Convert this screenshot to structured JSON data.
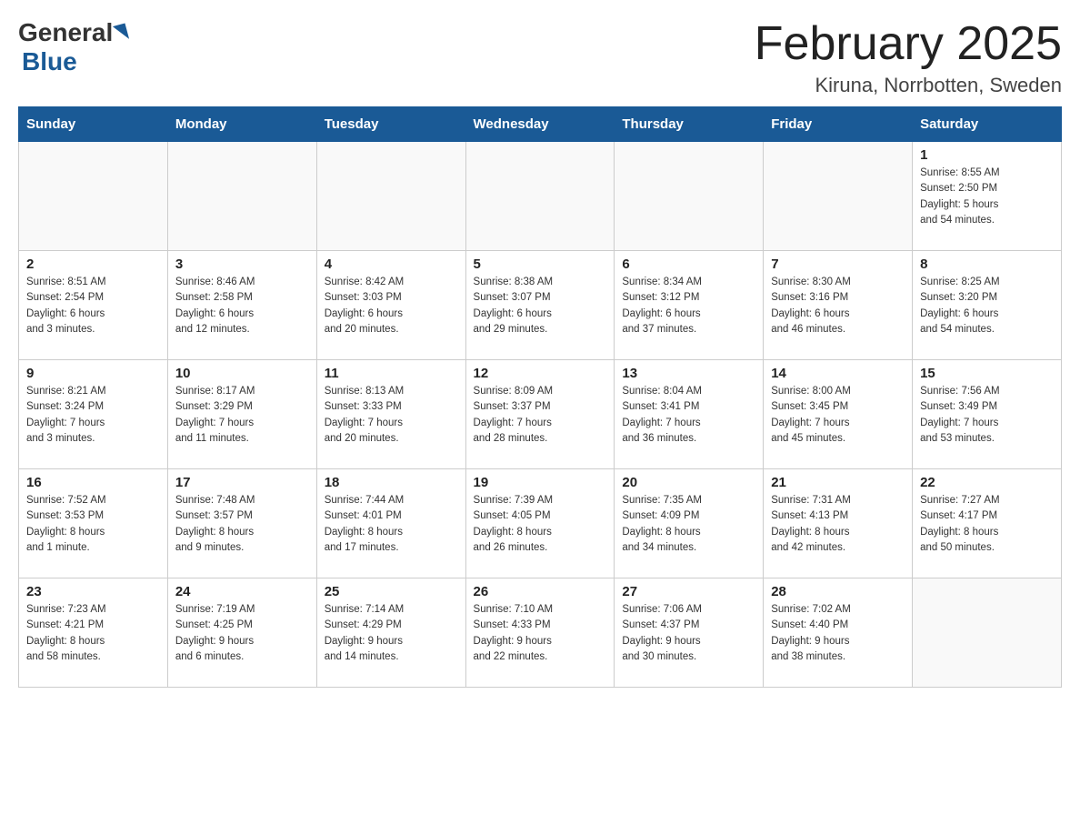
{
  "header": {
    "logo_general": "General",
    "logo_blue": "Blue",
    "title": "February 2025",
    "subtitle": "Kiruna, Norrbotten, Sweden"
  },
  "days_of_week": [
    "Sunday",
    "Monday",
    "Tuesday",
    "Wednesday",
    "Thursday",
    "Friday",
    "Saturday"
  ],
  "weeks": [
    {
      "days": [
        {
          "number": "",
          "info": ""
        },
        {
          "number": "",
          "info": ""
        },
        {
          "number": "",
          "info": ""
        },
        {
          "number": "",
          "info": ""
        },
        {
          "number": "",
          "info": ""
        },
        {
          "number": "",
          "info": ""
        },
        {
          "number": "1",
          "info": "Sunrise: 8:55 AM\nSunset: 2:50 PM\nDaylight: 5 hours\nand 54 minutes."
        }
      ]
    },
    {
      "days": [
        {
          "number": "2",
          "info": "Sunrise: 8:51 AM\nSunset: 2:54 PM\nDaylight: 6 hours\nand 3 minutes."
        },
        {
          "number": "3",
          "info": "Sunrise: 8:46 AM\nSunset: 2:58 PM\nDaylight: 6 hours\nand 12 minutes."
        },
        {
          "number": "4",
          "info": "Sunrise: 8:42 AM\nSunset: 3:03 PM\nDaylight: 6 hours\nand 20 minutes."
        },
        {
          "number": "5",
          "info": "Sunrise: 8:38 AM\nSunset: 3:07 PM\nDaylight: 6 hours\nand 29 minutes."
        },
        {
          "number": "6",
          "info": "Sunrise: 8:34 AM\nSunset: 3:12 PM\nDaylight: 6 hours\nand 37 minutes."
        },
        {
          "number": "7",
          "info": "Sunrise: 8:30 AM\nSunset: 3:16 PM\nDaylight: 6 hours\nand 46 minutes."
        },
        {
          "number": "8",
          "info": "Sunrise: 8:25 AM\nSunset: 3:20 PM\nDaylight: 6 hours\nand 54 minutes."
        }
      ]
    },
    {
      "days": [
        {
          "number": "9",
          "info": "Sunrise: 8:21 AM\nSunset: 3:24 PM\nDaylight: 7 hours\nand 3 minutes."
        },
        {
          "number": "10",
          "info": "Sunrise: 8:17 AM\nSunset: 3:29 PM\nDaylight: 7 hours\nand 11 minutes."
        },
        {
          "number": "11",
          "info": "Sunrise: 8:13 AM\nSunset: 3:33 PM\nDaylight: 7 hours\nand 20 minutes."
        },
        {
          "number": "12",
          "info": "Sunrise: 8:09 AM\nSunset: 3:37 PM\nDaylight: 7 hours\nand 28 minutes."
        },
        {
          "number": "13",
          "info": "Sunrise: 8:04 AM\nSunset: 3:41 PM\nDaylight: 7 hours\nand 36 minutes."
        },
        {
          "number": "14",
          "info": "Sunrise: 8:00 AM\nSunset: 3:45 PM\nDaylight: 7 hours\nand 45 minutes."
        },
        {
          "number": "15",
          "info": "Sunrise: 7:56 AM\nSunset: 3:49 PM\nDaylight: 7 hours\nand 53 minutes."
        }
      ]
    },
    {
      "days": [
        {
          "number": "16",
          "info": "Sunrise: 7:52 AM\nSunset: 3:53 PM\nDaylight: 8 hours\nand 1 minute."
        },
        {
          "number": "17",
          "info": "Sunrise: 7:48 AM\nSunset: 3:57 PM\nDaylight: 8 hours\nand 9 minutes."
        },
        {
          "number": "18",
          "info": "Sunrise: 7:44 AM\nSunset: 4:01 PM\nDaylight: 8 hours\nand 17 minutes."
        },
        {
          "number": "19",
          "info": "Sunrise: 7:39 AM\nSunset: 4:05 PM\nDaylight: 8 hours\nand 26 minutes."
        },
        {
          "number": "20",
          "info": "Sunrise: 7:35 AM\nSunset: 4:09 PM\nDaylight: 8 hours\nand 34 minutes."
        },
        {
          "number": "21",
          "info": "Sunrise: 7:31 AM\nSunset: 4:13 PM\nDaylight: 8 hours\nand 42 minutes."
        },
        {
          "number": "22",
          "info": "Sunrise: 7:27 AM\nSunset: 4:17 PM\nDaylight: 8 hours\nand 50 minutes."
        }
      ]
    },
    {
      "days": [
        {
          "number": "23",
          "info": "Sunrise: 7:23 AM\nSunset: 4:21 PM\nDaylight: 8 hours\nand 58 minutes."
        },
        {
          "number": "24",
          "info": "Sunrise: 7:19 AM\nSunset: 4:25 PM\nDaylight: 9 hours\nand 6 minutes."
        },
        {
          "number": "25",
          "info": "Sunrise: 7:14 AM\nSunset: 4:29 PM\nDaylight: 9 hours\nand 14 minutes."
        },
        {
          "number": "26",
          "info": "Sunrise: 7:10 AM\nSunset: 4:33 PM\nDaylight: 9 hours\nand 22 minutes."
        },
        {
          "number": "27",
          "info": "Sunrise: 7:06 AM\nSunset: 4:37 PM\nDaylight: 9 hours\nand 30 minutes."
        },
        {
          "number": "28",
          "info": "Sunrise: 7:02 AM\nSunset: 4:40 PM\nDaylight: 9 hours\nand 38 minutes."
        },
        {
          "number": "",
          "info": ""
        }
      ]
    }
  ]
}
